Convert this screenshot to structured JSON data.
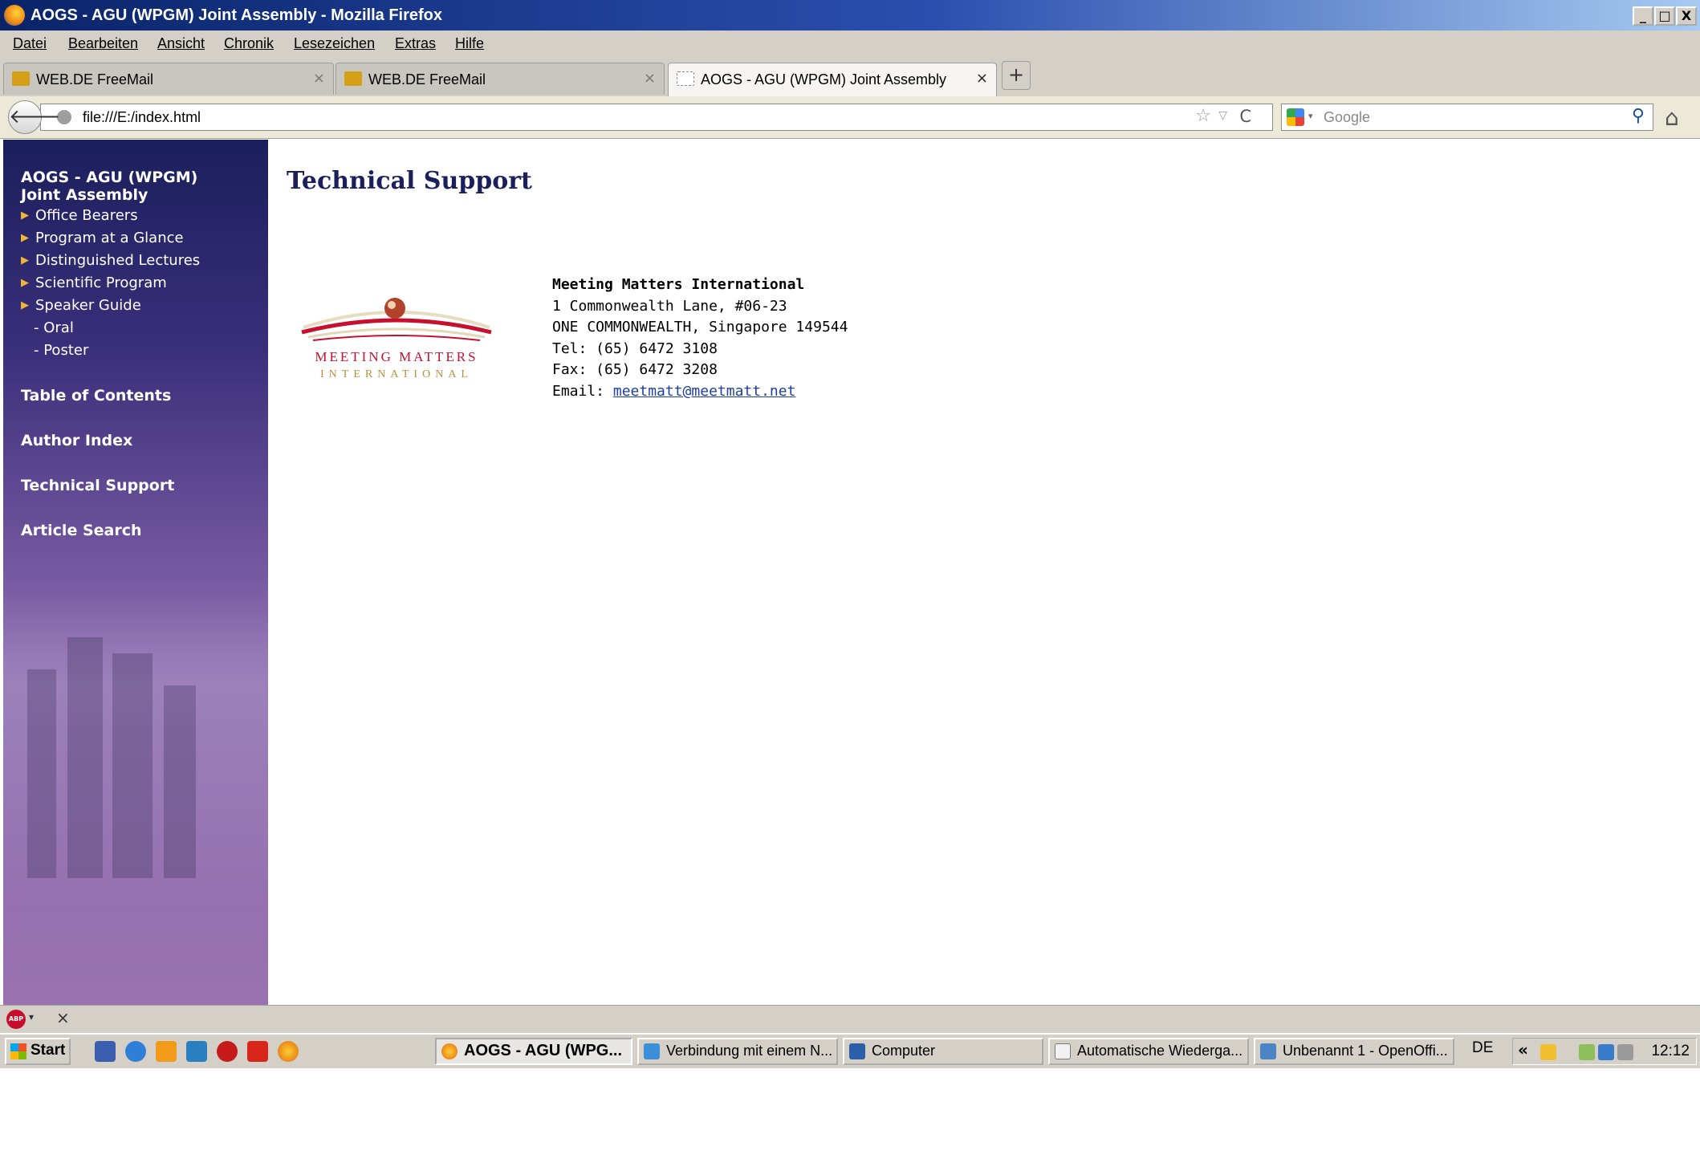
{
  "window": {
    "title": "AOGS - AGU (WPGM) Joint Assembly - Mozilla Firefox",
    "controls": {
      "minimize": "_",
      "maximize": "□",
      "close": "X"
    }
  },
  "menu": [
    "Datei",
    "Bearbeiten",
    "Ansicht",
    "Chronik",
    "Lesezeichen",
    "Extras",
    "Hilfe"
  ],
  "tabs": [
    {
      "label": "WEB.DE FreeMail",
      "active": false,
      "icon": "webde-icon"
    },
    {
      "label": "WEB.DE FreeMail",
      "active": false,
      "icon": "webde-icon"
    },
    {
      "label": "AOGS - AGU (WPGM) Joint Assembly",
      "active": true,
      "icon": "blank-page-icon"
    }
  ],
  "tab_close": "×",
  "new_tab": "+",
  "nav": {
    "back": "🡐",
    "url": "file:///E:/index.html",
    "search_placeholder": "Google",
    "search_arrow": "▾",
    "bookmark_star": "☆",
    "url_drop": "▽",
    "reload": "C",
    "search_go": "⚲",
    "home": "⌂"
  },
  "sidebar": {
    "heading_line1": "AOGS - AGU (WPGM)",
    "heading_line2": "Joint Assembly",
    "bullet": "▶",
    "items": [
      "Office Bearers",
      "Program at a Glance",
      "Distinguished Lectures",
      "Scientific Program",
      "Speaker Guide"
    ],
    "subitems": [
      "- Oral",
      "- Poster"
    ],
    "sections": [
      "Table of Contents",
      "Author Index",
      "Technical Support",
      "Article Search"
    ]
  },
  "main": {
    "title": "Technical Support",
    "logo": {
      "line1": "MEETING MATTERS",
      "line2": "INTERNATIONAL"
    },
    "contact": {
      "name": "Meeting Matters International",
      "address1": "1 Commonwealth Lane, #06-23",
      "address2": "ONE COMMONWEALTH, Singapore 149544",
      "tel": "Tel: (65) 6472 3108",
      "fax": "Fax: (65) 6472 3208",
      "email_label": "Email: ",
      "email": "meetmatt@meetmatt.net"
    }
  },
  "addon_bar": {
    "abp": "ABP",
    "dropdown": "▾",
    "close": "×"
  },
  "taskbar": {
    "start": "Start",
    "quicklaunch": [
      "show-desktop-icon",
      "internet-explorer-icon",
      "media-player-icon",
      "network-icon",
      "acrobat-icon",
      "pdf-icon",
      "firefox-icon"
    ],
    "buttons": [
      {
        "label": "AOGS - AGU (WPG...",
        "active": true,
        "icon": "firefox-icon"
      },
      {
        "label": "Verbindung mit einem N...",
        "active": false,
        "icon": "network-connection-icon"
      },
      {
        "label": "Computer",
        "active": false,
        "icon": "computer-icon"
      },
      {
        "label": "Automatische Wiederga...",
        "active": false,
        "icon": "autoplay-icon"
      },
      {
        "label": "Unbenannt 1 - OpenOffi...",
        "active": false,
        "icon": "openoffice-icon"
      }
    ],
    "language": "DE",
    "tray_chevron": "«",
    "clock": "12:12"
  },
  "colors": {
    "titlebar": "#0a246a",
    "sidebar_top": "#1b1f5c",
    "sidebar_bottom": "#9a72b0",
    "page_title": "#1b1f5c",
    "link": "#1c3fa8",
    "logo_red": "#c8102e",
    "logo_gold": "#b8913a"
  }
}
